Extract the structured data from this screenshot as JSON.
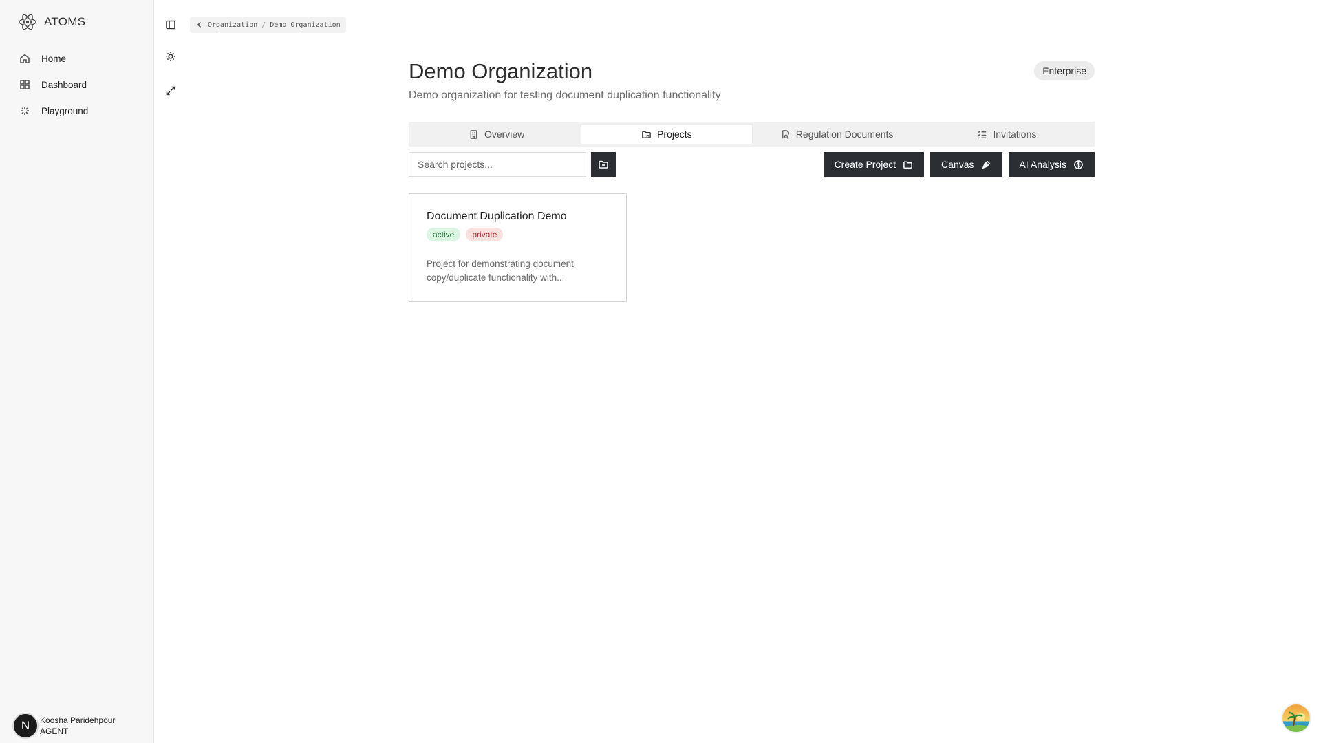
{
  "sidebar": {
    "brand": "ATOMS",
    "items": [
      {
        "label": "Home",
        "icon": "home-icon"
      },
      {
        "label": "Dashboard",
        "icon": "dashboard-icon"
      },
      {
        "label": "Playground",
        "icon": "sparkle-icon"
      }
    ],
    "user": {
      "initial": "N",
      "name": "Koosha Paridehpour",
      "role": "AGENT"
    }
  },
  "toolbar": {
    "icons": [
      "sidebar-toggle-icon",
      "theme-sun-icon",
      "expand-icon"
    ]
  },
  "breadcrumb": {
    "parent": "Organization",
    "separator": "/",
    "current": "Demo Organization"
  },
  "header": {
    "title": "Demo Organization",
    "description": "Demo organization for testing document duplication functionality",
    "plan_badge": "Enterprise"
  },
  "tabs": [
    {
      "label": "Overview",
      "icon": "building-icon"
    },
    {
      "label": "Projects",
      "icon": "folder-icon",
      "active": true
    },
    {
      "label": "Regulation Documents",
      "icon": "file-search-icon"
    },
    {
      "label": "Invitations",
      "icon": "list-check-icon"
    }
  ],
  "search": {
    "placeholder": "Search projects..."
  },
  "actions": {
    "create": "Create Project",
    "canvas": "Canvas",
    "ai": "AI Analysis"
  },
  "projects": [
    {
      "title": "Document Duplication Demo",
      "status": "active",
      "visibility": "private",
      "description": "Project for demonstrating document copy/duplicate functionality with..."
    }
  ],
  "colors": {
    "primary_button": "#2b2e33",
    "active_badge": "#dcf5e3",
    "private_badge": "#fbe0e0"
  }
}
